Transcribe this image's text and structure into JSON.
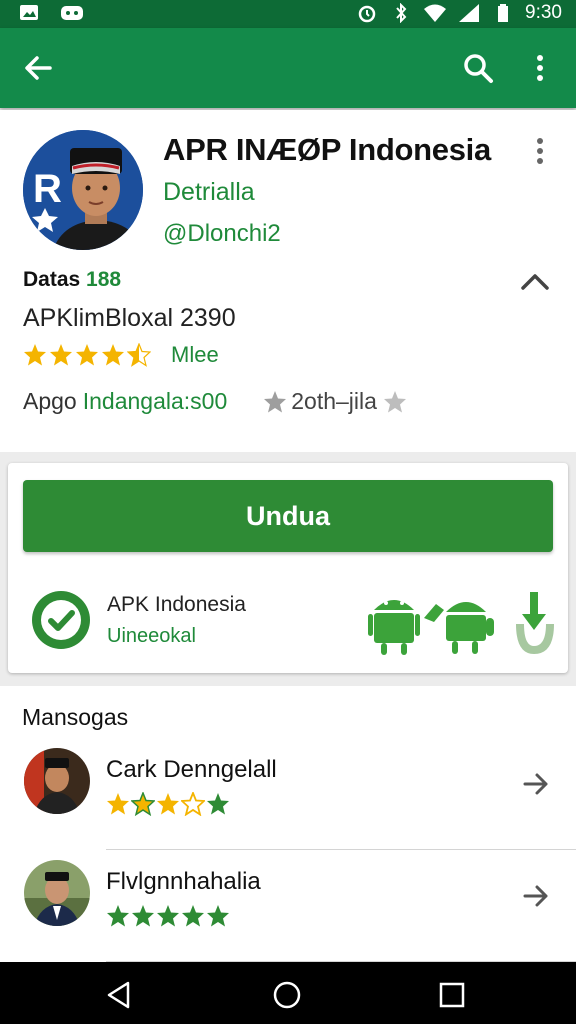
{
  "status_bar": {
    "time": "9:30",
    "icons": [
      "image-icon",
      "game-icon",
      "alarm-icon",
      "bluetooth-icon",
      "wifi-icon",
      "signal-icon",
      "battery-icon"
    ]
  },
  "app_bar": {
    "icons": [
      "back-arrow-icon",
      "search-icon",
      "more-vert-icon"
    ],
    "color": "#138a4a"
  },
  "app": {
    "title": "APR INÆØP Indonesia",
    "developer": "Detrialla",
    "handle": "@Dlonchi2",
    "data_label": "Datas",
    "data_value": "188",
    "apk_line": "APKlimBloxal 2390",
    "rating_stars": 4.5,
    "rating_more": "Mlee",
    "meta_prefix": "Apgo",
    "meta_green": "Indangala:s00",
    "meta_right": "2oth–jila"
  },
  "install": {
    "button_label": "Undua",
    "verify_title": "APK Indonesia",
    "verify_sub": "Uineeokal",
    "accent": "#2e8b35"
  },
  "reviews": {
    "title": "Mansogas",
    "items": [
      {
        "name": "Cark Denngelall",
        "stars": [
          "gold",
          "gold-half",
          "gold",
          "gold-outline",
          "green"
        ]
      },
      {
        "name": "Flvlgnnhahalia",
        "stars": [
          "green",
          "green",
          "green",
          "green",
          "green"
        ]
      }
    ]
  },
  "nav_bar": {
    "icons": [
      "back-triangle-icon",
      "home-circle-icon",
      "recents-square-icon"
    ]
  }
}
